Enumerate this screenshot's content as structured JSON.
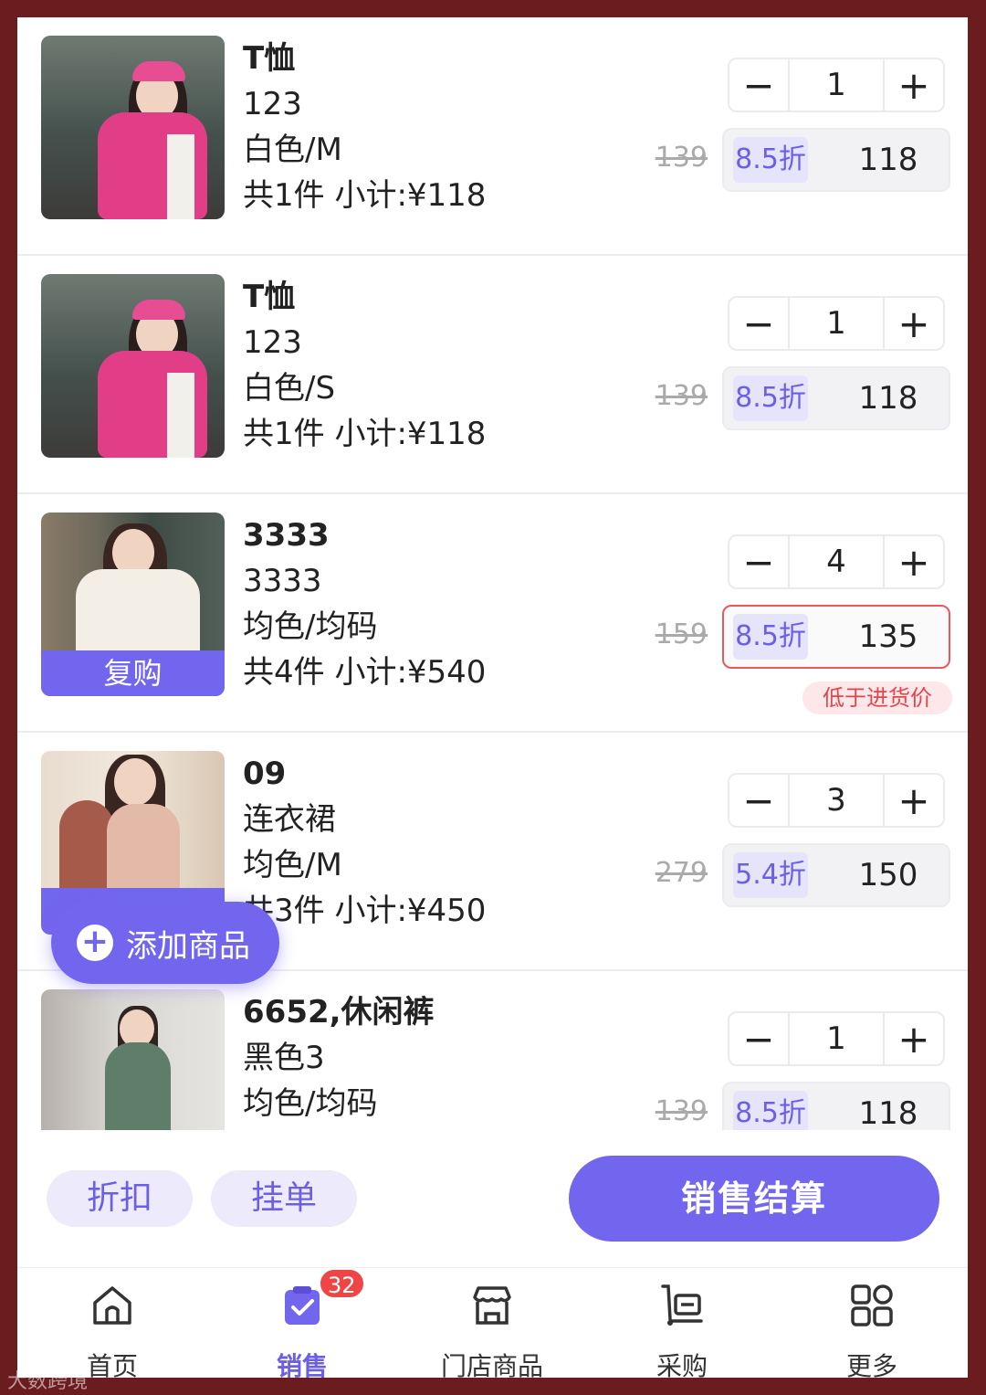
{
  "items": [
    {
      "title": "T恤",
      "code": "123",
      "variant": "白色/M",
      "summary": "共1件 小计:¥118",
      "qty": "1",
      "orig_price": "139",
      "discount": "8.5折",
      "price": "118",
      "rebuy": "",
      "warning": ""
    },
    {
      "title": "T恤",
      "code": "123",
      "variant": "白色/S",
      "summary": "共1件 小计:¥118",
      "qty": "1",
      "orig_price": "139",
      "discount": "8.5折",
      "price": "118",
      "rebuy": "",
      "warning": ""
    },
    {
      "title": "3333",
      "code": "3333",
      "variant": "均色/均码",
      "summary": "共4件 小计:¥540",
      "qty": "4",
      "orig_price": "159",
      "discount": "8.5折",
      "price": "135",
      "rebuy": "复购",
      "warning": "低于进货价"
    },
    {
      "title": "09",
      "code": "连衣裙",
      "variant": "均色/M",
      "summary": "共3件 小计:¥450",
      "qty": "3",
      "orig_price": "279",
      "discount": "5.4折",
      "price": "150",
      "rebuy": "",
      "warning": ""
    },
    {
      "title": "6652,休闲裤",
      "code": "黑色3",
      "variant": "均色/均码",
      "summary": "",
      "qty": "1",
      "orig_price": "139",
      "discount": "8.5折",
      "price": "118",
      "rebuy": "",
      "warning": ""
    }
  ],
  "stepper": {
    "minus": "−",
    "plus": "+"
  },
  "fab": {
    "icon": "plus-icon",
    "label": "添加商品"
  },
  "actions": {
    "discount_label": "折扣",
    "hold_label": "挂单",
    "checkout_label": "销售结算"
  },
  "tabbar": {
    "tabs": [
      {
        "label": "首页",
        "icon": "home-icon"
      },
      {
        "label": "销售",
        "icon": "sales-clipboard-icon",
        "badge": "32"
      },
      {
        "label": "门店商品",
        "icon": "store-icon"
      },
      {
        "label": "采购",
        "icon": "purchase-cart-icon"
      },
      {
        "label": "更多",
        "icon": "more-grid-icon"
      }
    ]
  },
  "watermark": "大数跨境",
  "colors": {
    "accent": "#7266ee",
    "warning": "#e0474d",
    "background": "#6b1c1f"
  }
}
